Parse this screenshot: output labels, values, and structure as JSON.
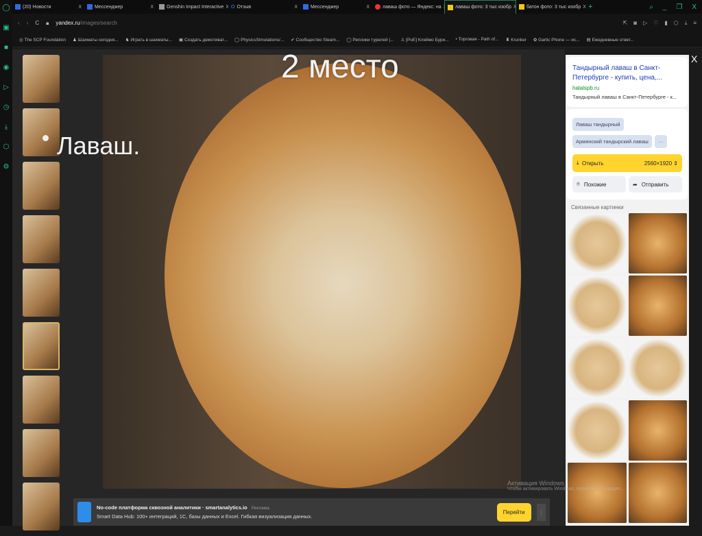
{
  "tabs": [
    {
      "label": "(20) Новости"
    },
    {
      "label": "Мессенджер"
    },
    {
      "label": "Genshin Impact Interactive"
    },
    {
      "label": "Отзыв"
    },
    {
      "label": "Мессенджер"
    },
    {
      "label": "лаваш фото — Яндекс: на"
    },
    {
      "label": "лаваш фото: 3 тыс изобр"
    },
    {
      "label": "батон фото: 3 тыс изобр"
    }
  ],
  "address": {
    "url_host": "yandex.ru",
    "url_path": "/images/search"
  },
  "bookmarks": [
    "The SCP Foundation",
    "Шахматы сегодня...",
    "Играть в шахматы...",
    "Создать демотиват...",
    "PhysicsSimulations/...",
    "Сообщество Steam...",
    "Реплики турелей |...",
    "[PoE] Клеймо Бури...",
    "Торговая - Path of...",
    "Krunker",
    "Gartic Phone — ис...",
    "Ежедневные ответ..."
  ],
  "slide": {
    "title": "2 место",
    "bullet": "Лаваш."
  },
  "panel": {
    "title": "Тандырный лаваш в Санкт-Петербурге - купить, цена,...",
    "site": "halalspb.ru",
    "description": "Тандырный лаваш в Санкт-Петербурге - к...",
    "chips": [
      "Лаваш тандырный",
      "Армянский тандырский лаваш",
      "···"
    ],
    "open_label": "Открыть",
    "resolution": "2560×1920",
    "similar_label": "Похожие",
    "share_label": "Отправить",
    "related_heading": "Связанные картинки"
  },
  "ad": {
    "title": "No-code платформа сквозной аналитики · smartanalytics.io",
    "tag": "Реклама",
    "text": "Smart Data Hub: 100+ интеграций, 1С, базы данных и Excel. Гибкая визуализация данных.",
    "button": "Перейти"
  },
  "watermark": {
    "line1": "Активация Windows",
    "line2": "Чтобы активировать Windows, перейдите в раздел..."
  }
}
